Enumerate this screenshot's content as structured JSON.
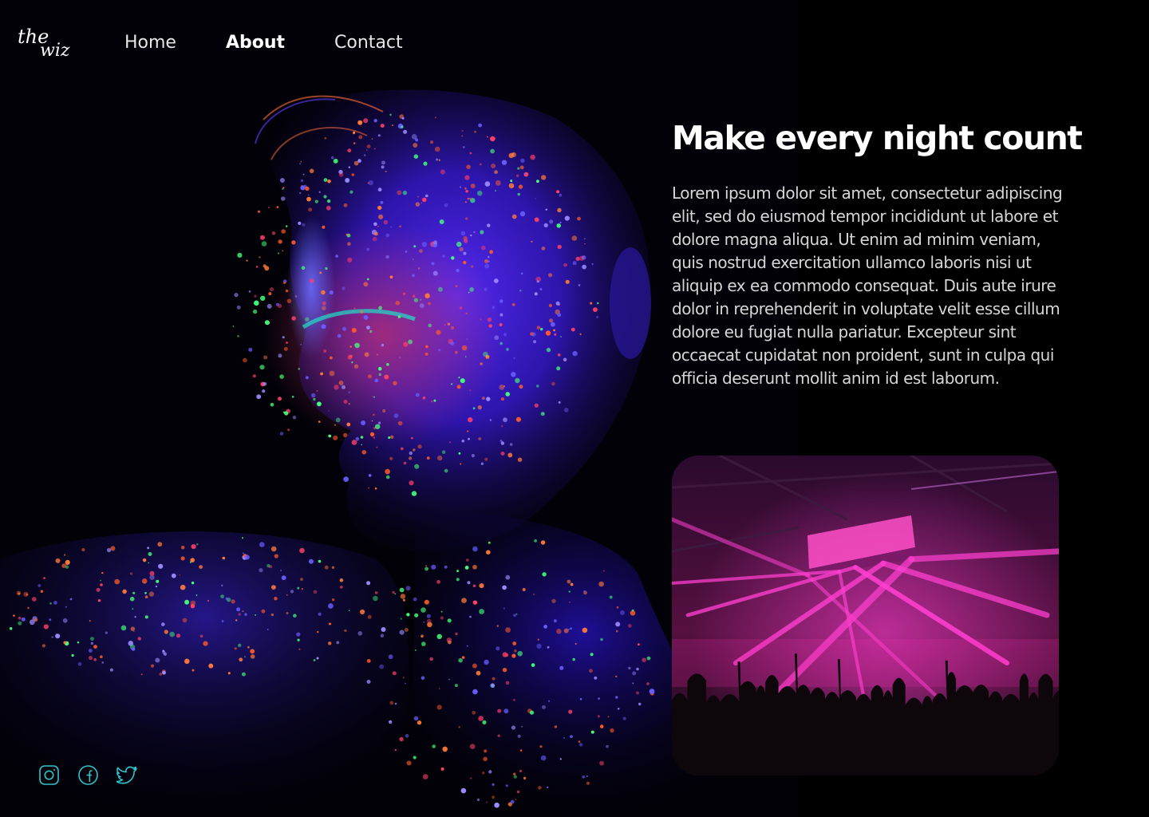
{
  "nav": {
    "items": [
      {
        "label": "Home",
        "active": false
      },
      {
        "label": "About",
        "active": true
      },
      {
        "label": "Contact",
        "active": false
      }
    ]
  },
  "logo": {
    "line1": "the",
    "line2": "wiz"
  },
  "content": {
    "headline": "Make every night count",
    "body": "Lorem ipsum dolor sit amet, consectetur adipiscing elit, sed do eiusmod tempor incididunt ut labore et dolore magna aliqua. Ut enim ad minim veniam, quis nostrud exercitation ullamco laboris nisi ut aliquip ex ea commodo consequat. Duis aute irure dolor in reprehenderit in voluptate velit esse cillum dolore eu fugiat nulla pariatur. Excepteur sint occaecat cupidatat non proident, sunt in culpa qui officia deserunt mollit anim id est laborum."
  },
  "images": {
    "hero": "neon-painted-face-photo",
    "event": "concert-stage-lights-photo"
  },
  "social": [
    {
      "icon": "instagram-icon"
    },
    {
      "icon": "facebook-icon"
    },
    {
      "icon": "twitter-icon"
    }
  ],
  "colors": {
    "background": "#000000",
    "text": "#ffffff",
    "body_text": "#d6d6d6",
    "social_icon": "#2fc4c9",
    "neon_blue": "#3a2bff",
    "neon_orange": "#ff5a2a",
    "neon_green": "#44ff7a",
    "stage_magenta": "#ff2fd0"
  }
}
